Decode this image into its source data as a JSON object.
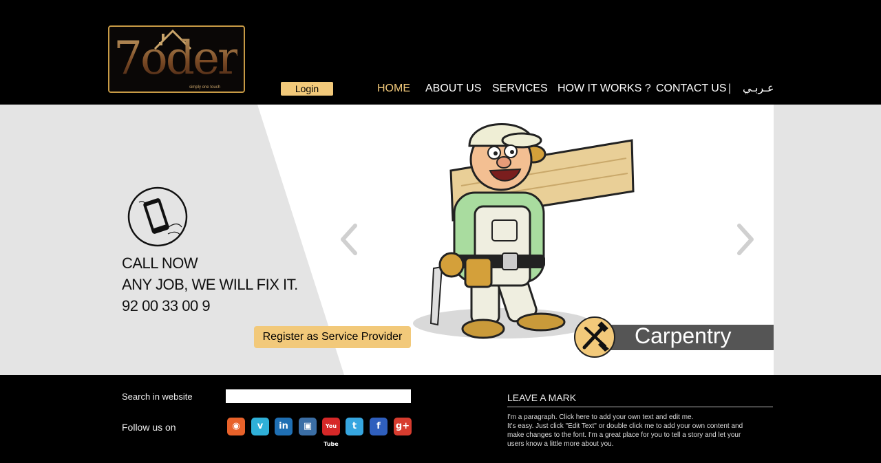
{
  "brand": {
    "logo_text": "7oder",
    "tagline": "simply one touch"
  },
  "header": {
    "login_label": "Login",
    "nav": {
      "home": "HOME",
      "about": "ABOUT US",
      "services": "SERVICES",
      "how": "HOW IT WORKS ?",
      "contact": "CONTACT US",
      "separator": "|",
      "arabic": "عـربـي"
    }
  },
  "hero": {
    "cta_lines": [
      "CALL NOW",
      "ANY JOB, WE WILL FIX IT.",
      "92 00 33 00 9"
    ],
    "register_label": "Register as Service Provider",
    "service_label": "Carpentry"
  },
  "footer": {
    "search_label": "Search  in website",
    "search_value": "",
    "follow_label": "Follow us on",
    "social": {
      "rss": "rss-icon",
      "vimeo": "vimeo-icon",
      "linkedin": "linkedin-icon",
      "instagram": "instagram-icon",
      "youtube": "youtube-icon",
      "twitter": "twitter-icon",
      "facebook": "facebook-icon",
      "googleplus": "google-plus-icon"
    },
    "social_glyphs": {
      "rss": "◉",
      "vimeo": "v",
      "linkedin": "in",
      "instagram": "▣",
      "youtube": "You Tube",
      "twitter": "t",
      "facebook": "f",
      "googleplus": "g+"
    },
    "leave_mark_title": "LEAVE A MARK",
    "leave_mark_p1": "I'm a paragraph. Click here to add your own text and edit me.",
    "leave_mark_p2": "It's easy. Just click \"Edit Text\" or double click me to add your own content and make changes to the font. I'm a great place for you to tell a story and let your users know a little more about you."
  },
  "colors": {
    "accent": "#f2c97a",
    "background": "#000000",
    "hero_bg": "#e4e4e4",
    "service_bar": "#555555"
  }
}
